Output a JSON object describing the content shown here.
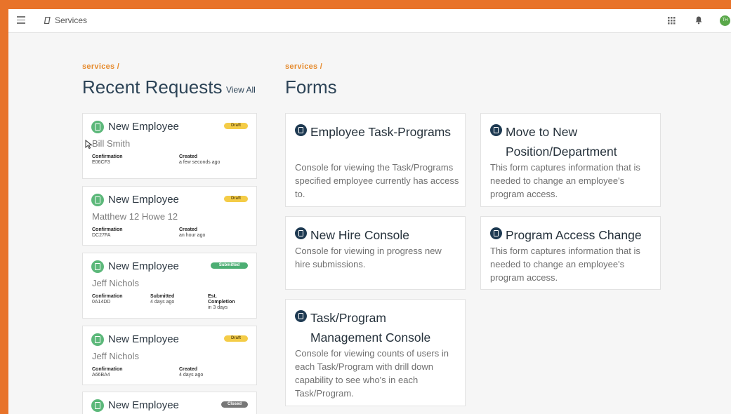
{
  "topbar": {
    "menu_icon": "hamburger-menu-icon",
    "breadcrumb_icon": "document-icon",
    "breadcrumb": "Services",
    "apps_icon": "grid-apps-icon",
    "notifications_icon": "bell-icon",
    "avatar_initials": "TH"
  },
  "recent": {
    "crumb": "services /",
    "title": "Recent Requests",
    "view_all": "View All",
    "cards": [
      {
        "title": "New Employee",
        "badge": "Draft",
        "name": "Bill Smith",
        "meta": [
          {
            "label": "Confirmation",
            "value": "E06CF3"
          },
          {
            "label": "Created",
            "value": "a few seconds ago"
          }
        ]
      },
      {
        "title": "New Employee",
        "badge": "Draft",
        "name": "Matthew 12 Howe 12",
        "meta": [
          {
            "label": "Confirmation",
            "value": "DC27FA"
          },
          {
            "label": "Created",
            "value": "an hour ago"
          }
        ]
      },
      {
        "title": "New Employee",
        "badge": "Submitted",
        "name": "Jeff Nichols",
        "meta": [
          {
            "label": "Confirmation",
            "value": "0A14DD"
          },
          {
            "label": "Submitted",
            "value": "4 days ago"
          },
          {
            "label": "Est. Completion",
            "value": "in 3 days"
          }
        ]
      },
      {
        "title": "New Employee",
        "badge": "Draft",
        "name": "Jeff Nichols",
        "meta": [
          {
            "label": "Confirmation",
            "value": "A66BA4"
          },
          {
            "label": "Created",
            "value": "4 days ago"
          }
        ]
      },
      {
        "title": "New Employee",
        "badge": "Closed"
      }
    ]
  },
  "forms": {
    "crumb": "services /",
    "title": "Forms",
    "cards": [
      {
        "title": "Employee Task-Programs",
        "desc": "Console for viewing the Task/Programs specified employee currently has access to."
      },
      {
        "title": "Move to New Position/Department",
        "desc": "This form captures information that is needed to change an employee's program access."
      },
      {
        "title": "New Hire Console",
        "desc": "Console for viewing in progress new hire submissions."
      },
      {
        "title": "Program Access Change",
        "desc": "This form captures information that is needed to change an employee's program access."
      },
      {
        "title": "Task/Program Management Console",
        "desc": "Console for viewing counts of users in each Task/Program with drill down capability to see who's in each Task/Program."
      }
    ]
  },
  "colors": {
    "outer_background": "#e8732a",
    "accent_orange": "#e58a2c",
    "heading_navy": "#2d4457",
    "request_icon_green": "#5cb87a",
    "form_icon_navy": "#1e3a52",
    "badge_draft": "#f4cc47",
    "badge_submitted": "#4cae73",
    "badge_closed": "#777777"
  }
}
